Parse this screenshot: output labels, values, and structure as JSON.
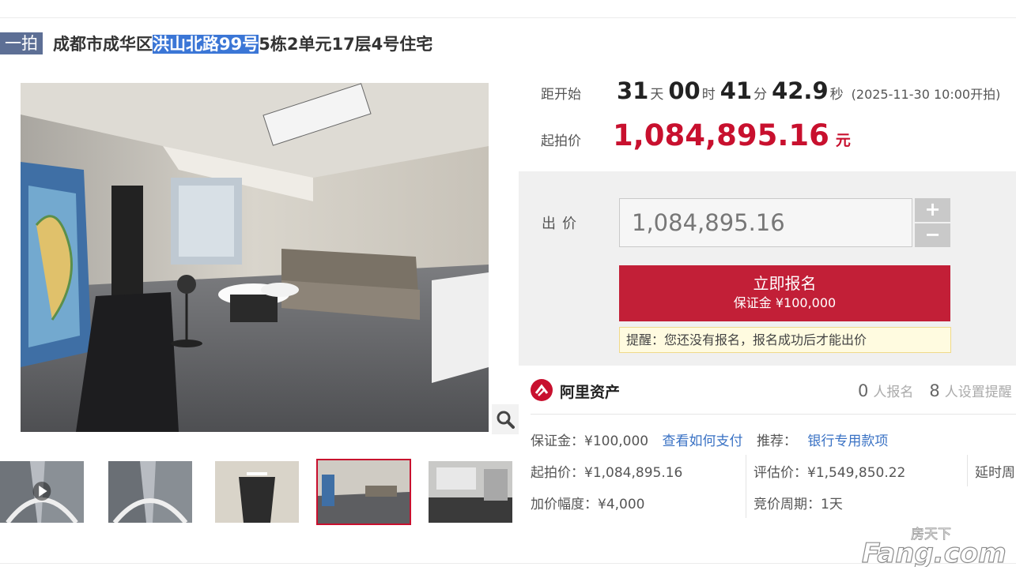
{
  "header": {
    "badge": "一拍",
    "title_prefix": "成都市成华区",
    "title_highlight": "洪山北路99号",
    "title_suffix": "5栋2单元17层4号住宅"
  },
  "countdown": {
    "label": "距开始",
    "days": "31",
    "days_unit": "天",
    "hours": "00",
    "hours_unit": "时",
    "minutes": "41",
    "minutes_unit": "分",
    "seconds": "42.9",
    "seconds_unit": "秒",
    "start_note": "(2025-11-30 10:00开拍)"
  },
  "starting_price": {
    "label": "起拍价",
    "value": "1,084,895.16",
    "unit": "元"
  },
  "bid": {
    "label": "出价",
    "input_value": "1,084,895.16",
    "plus": "+",
    "minus": "−",
    "register_label": "立即报名",
    "deposit_note": "保证金 ¥100,000",
    "reminder": "提醒：您还没有报名，报名成功后才能出价"
  },
  "platform": {
    "name": "阿里资产",
    "registered_count": "0",
    "registered_label": "人报名",
    "reminder_count": "8",
    "reminder_label": "人设置提醒"
  },
  "details": {
    "deposit": "保证金：¥100,000",
    "how_to_pay": "查看如何支付",
    "recommend_label": "推荐：",
    "bank_link": "银行专用款项",
    "start_price": "起拍价：¥1,084,895.16",
    "assessed": "评估价：¥1,549,850.22",
    "delay": "延时周",
    "increment": "加价幅度：¥4,000",
    "period": "竞价周期：1天"
  },
  "watermark": {
    "top": "房天下",
    "brand": "Fang.com"
  },
  "colors": {
    "accent_red": "#c8102e",
    "badge_blue": "#5d6f95",
    "link_blue": "#3a72c4"
  }
}
